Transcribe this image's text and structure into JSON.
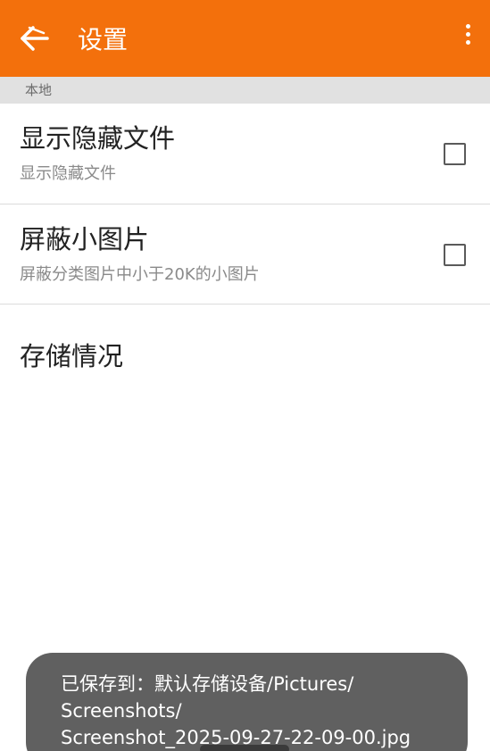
{
  "app_bar": {
    "title": "设置",
    "back_icon": "back-arrow-icon",
    "overflow_icon": "more-vertical-icon",
    "color": "#f3700c"
  },
  "section": {
    "header": "本地"
  },
  "preferences": [
    {
      "title": "显示隐藏文件",
      "summary": "显示隐藏文件",
      "checked": false
    },
    {
      "title": "屏蔽小图片",
      "summary": "屏蔽分类图片中小于20K的小图片",
      "checked": false
    },
    {
      "title": "存储情况"
    }
  ],
  "toast": {
    "lines": [
      "已保存到：默认存储设备/Pictures/",
      "Screenshots/",
      "Screenshot_2025-09-27-22-09-00.jpg"
    ]
  }
}
